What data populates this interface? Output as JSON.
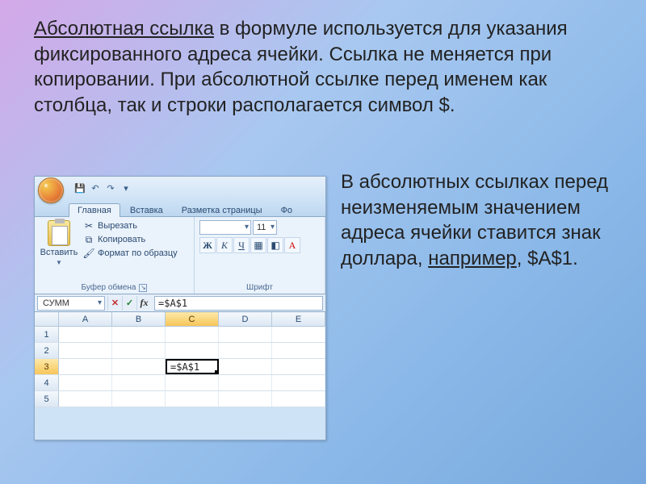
{
  "slide": {
    "intro_underlined": "Абсолютная ссылка",
    "intro_rest": " в формуле используется для указания фиксированного адреса ячейки. Ссылка не меняется при копировании. При абсолютной ссылке перед именем как столбца, так и строки располагается символ $.",
    "side_before": "В абсолютных ссылках перед неизменяемым значением адреса ячейки ставится знак доллара, ",
    "side_underlined": "например",
    "side_after": ", $A$1."
  },
  "excel": {
    "tabs": {
      "home": "Главная",
      "insert": "Вставка",
      "pagelayout": "Разметка страницы",
      "formulas": "Фо"
    },
    "clipboard": {
      "paste": "Вставить",
      "cut": "Вырезать",
      "copy": "Копировать",
      "format_painter": "Формат по образцу",
      "group_label": "Буфер обмена"
    },
    "font": {
      "size": "11",
      "group_label": "Шрифт",
      "bold": "Ж",
      "italic": "К",
      "under": "Ч"
    },
    "name_box": "СУММ",
    "formula": "=$A$1",
    "columns": [
      "A",
      "B",
      "C",
      "D",
      "E"
    ],
    "rows": [
      "1",
      "2",
      "3",
      "4",
      "5"
    ],
    "active_cell_value": "=$A$1"
  }
}
